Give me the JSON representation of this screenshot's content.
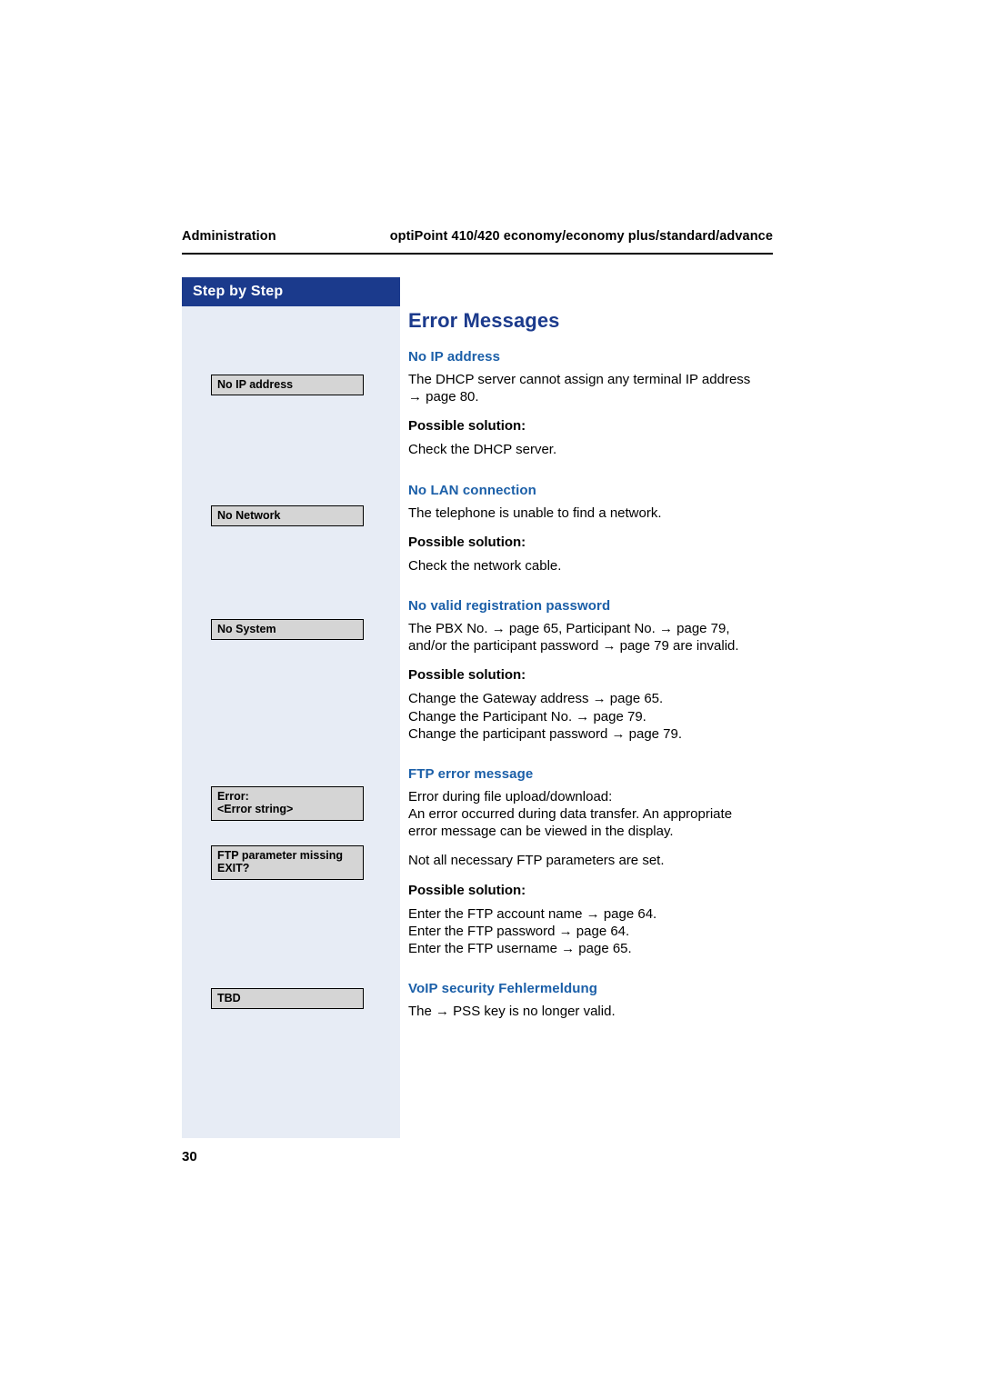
{
  "header": {
    "left": "Administration",
    "right": "optiPoint 410/420 economy/economy plus/standard/advance"
  },
  "sidebar": {
    "banner_label": "Step by Step",
    "display_keys": [
      {
        "line1": "No IP address",
        "line2": ""
      },
      {
        "line1": "No Network",
        "line2": ""
      },
      {
        "line1": "No System",
        "line2": ""
      },
      {
        "line1": "Error:",
        "line2": "<Error string>"
      },
      {
        "line1": "FTP parameter missing",
        "line2": "EXIT?"
      },
      {
        "line1": "TBD",
        "line2": ""
      }
    ]
  },
  "main": {
    "title": "Error Messages",
    "possible_solution_label": "Possible solution:",
    "sections": [
      {
        "heading": "No IP address",
        "description_line1": "The DHCP server cannot assign any terminal IP address",
        "description_line2": "→ page 80.",
        "solution": "Check the DHCP server."
      },
      {
        "heading": "No LAN connection",
        "description_line1": "The telephone is unable to find a network.",
        "solution": "Check the network cable."
      },
      {
        "heading": "No valid registration password",
        "description_line1": "The PBX No. → page 65, Participant No. → page 79,",
        "description_line2": "and/or the participant password → page 79 are invalid.",
        "solution_line1": "Change the Gateway address → page 65.",
        "solution_line2": "Change the Participant No. → page 79.",
        "solution_line3": "Change the participant password → page 79."
      },
      {
        "heading": "FTP error message",
        "description_line1": "Error during file upload/download:",
        "description_line2": "An error occurred during data transfer. An appropriate",
        "description_line3": "error message can be viewed in the display.",
        "description_line4": "Not all necessary FTP parameters are set.",
        "solution_line1": "Enter the FTP account name → page 64.",
        "solution_line2": "Enter the FTP password → page 64.",
        "solution_line3": "Enter the FTP username → page 65."
      },
      {
        "heading": "VoIP security Fehlermeldung",
        "description_line1": "The → PSS key is no longer valid."
      }
    ]
  },
  "folio": "30",
  "colors": {
    "banner_blue": "#1b3a8c",
    "sidebar_bg": "#e7ecf5",
    "heading_blue": "#1b5fa8",
    "keybox_bg": "#d5d5d5"
  }
}
